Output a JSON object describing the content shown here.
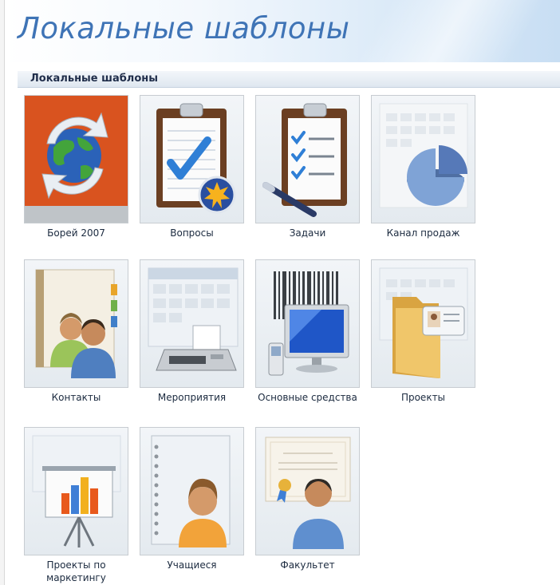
{
  "page": {
    "title": "Локальные шаблоны"
  },
  "section": {
    "header": "Локальные шаблоны"
  },
  "templates": [
    {
      "label": "Борей 2007",
      "icon": "globe-sync-icon"
    },
    {
      "label": "Вопросы",
      "icon": "clipboard-checkmark-icon"
    },
    {
      "label": "Задачи",
      "icon": "clipboard-tasks-icon"
    },
    {
      "label": "Канал продаж",
      "icon": "pie-chart-icon"
    },
    {
      "label": "Контакты",
      "icon": "contacts-people-icon"
    },
    {
      "label": "Мероприятия",
      "icon": "calendar-fax-icon"
    },
    {
      "label": "Основные средства",
      "icon": "monitor-barcode-icon"
    },
    {
      "label": "Проекты",
      "icon": "folder-id-card-icon"
    },
    {
      "label": "Проекты по маркетингу",
      "icon": "presentation-board-icon"
    },
    {
      "label": "Учащиеся",
      "icon": "student-notebook-icon"
    },
    {
      "label": "Факультет",
      "icon": "faculty-certificate-icon"
    }
  ],
  "colors": {
    "title": "#3f74b6",
    "accent_orange": "#d9531f"
  }
}
